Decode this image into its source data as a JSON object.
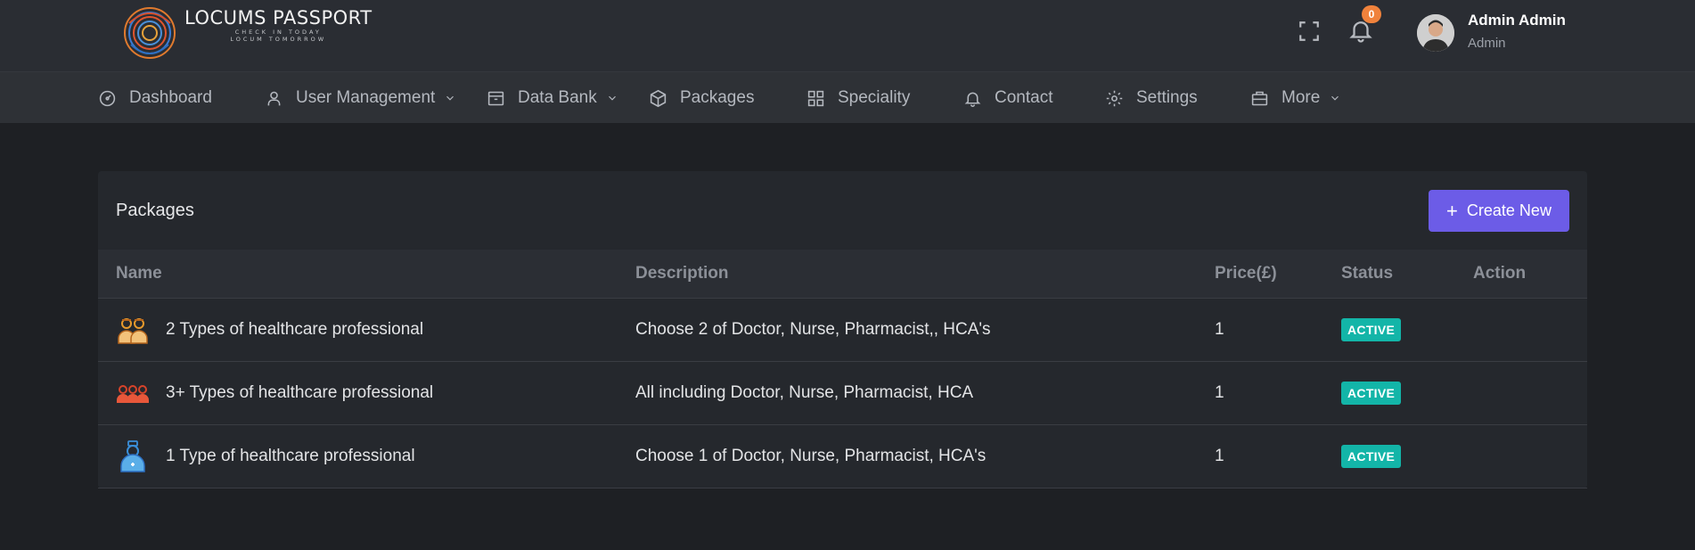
{
  "brand": {
    "title": "LOCUMS PASSPORT",
    "tagline_1": "CHECK IN TODAY",
    "tagline_2": "LOCUM TOMORROW"
  },
  "header": {
    "notification_count": "0",
    "user_name": "Admin Admin",
    "user_role": "Admin"
  },
  "nav": {
    "items": [
      {
        "label": "Dashboard",
        "icon": "dashboard-icon"
      },
      {
        "label": "User Management",
        "icon": "user-icon",
        "dropdown": true
      },
      {
        "label": "Data Bank",
        "icon": "archive-icon",
        "dropdown": true
      },
      {
        "label": "Packages",
        "icon": "box-icon"
      },
      {
        "label": "Speciality",
        "icon": "grid-icon"
      },
      {
        "label": "Contact",
        "icon": "bell-icon"
      },
      {
        "label": "Settings",
        "icon": "gear-icon"
      },
      {
        "label": "More",
        "icon": "briefcase-icon",
        "dropdown": true
      }
    ]
  },
  "packages": {
    "title": "Packages",
    "create_label": "Create New",
    "columns": [
      "Name",
      "Description",
      "Price(£)",
      "Status",
      "Action"
    ],
    "rows": [
      {
        "name": "2 Types of healthcare professional",
        "description": "Choose 2 of Doctor, Nurse, Pharmacist,, HCA's",
        "price": "1",
        "status": "ACTIVE",
        "icon": "two-professionals-icon"
      },
      {
        "name": "3+ Types of healthcare professional",
        "description": "All including Doctor, Nurse, Pharmacist, HCA",
        "price": "1",
        "status": "ACTIVE",
        "icon": "three-professionals-icon"
      },
      {
        "name": "1 Type of healthcare professional",
        "description": "Choose 1 of Doctor, Nurse, Pharmacist, HCA's",
        "price": "1",
        "status": "ACTIVE",
        "icon": "nurse-icon"
      }
    ]
  },
  "colors": {
    "accent": "#6c5ce7",
    "status_active": "#13b5a8",
    "badge": "#f0823c"
  }
}
